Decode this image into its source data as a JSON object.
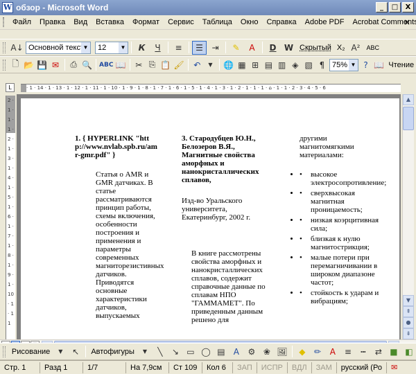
{
  "window": {
    "title": "обзор - Microsoft Word",
    "minimize": "_",
    "maximize": "□",
    "close": "X"
  },
  "menu": {
    "items": [
      "Файл",
      "Правка",
      "Вид",
      "Вставка",
      "Формат",
      "Сервис",
      "Таблица",
      "Окно",
      "Справка",
      "Adobe PDF",
      "Acrobat Comments"
    ],
    "close_doc": "×"
  },
  "format_toolbar": {
    "style": "Основной текст",
    "size": "12",
    "bold": "К",
    "underline": "Ч",
    "hidden_label": "Скрытый",
    "subscript": "X₂",
    "abc": "ABC"
  },
  "standard_toolbar": {
    "zoom": "75%",
    "read_label": "Чтение"
  },
  "ruler": {
    "h_ticks": "· 1 · 14 · 1 · 13 · 1 · 12 · 1 · 11 · 1 · 10 · 1 · 9 · 1 · 8 · 1 · 7 · 1 · 6 · 1 · 5 · 1 · 4 · 1 · 3 · 1 · 2 · 1 · 1 · 1 · ⌂ · 1 · 1 · 2 · 3 · 4 · 5 · 6",
    "v_ticks": "2 · 1 · 1 · 1 · 2 · 1 · 3 · 1 · 4 · 1 · 5 · 1 · 6 · 1 · 7 · 1 · 8 · 1 · 9 · 1 · 10 · 1 · 11"
  },
  "doc": {
    "col1_head": "1. { HYPERLINK \"http://www.nvlab.spb.ru/amr-gmr.pdf\" }",
    "col1_body": "Статья о AMR и GMR датчиках. В статье рассматриваются принцип работы, схемы включения, особенности построения и применения и параметры современных магниторезистивных датчиков. Приводятся основные характеристики датчиков, выпускаемых",
    "col2_head": "3. Стародубцев Ю.Н., Белозеров В.Я., Магнитные свойства аморфных и нанокристаллических сплавов,",
    "col2_pub": "Изд-во Уральского университета, Екатеринбург, 2002 г.",
    "col2_body": "В книге рассмотрены свойства аморфных и нанокристаллических сплавов, содержит справочные данные по сплавам НПО \"ГАММАМЕТ\". По приведенным данным решено для",
    "col3_intro": "другими магнитомягкими материалами:",
    "col3_list": [
      "высокое электросопротивление;",
      "сверхвысокая магнитная проницаемость;",
      "низкая коэрцитивная сила;",
      "близкая к нулю магнитострикция;",
      "малые потери при перемагничивании в широком диапазоне частот;",
      "стойкость к ударам и вибрациям;"
    ]
  },
  "drawing_toolbar": {
    "draw_label": "Рисование",
    "autoshapes_label": "Автофигуры"
  },
  "status": {
    "page": "Стр. 1",
    "section": "Разд 1",
    "pages": "1/7",
    "position": "На 7,9см",
    "line": "Ст 109",
    "column": "Кол 6",
    "rec": "ЗАП",
    "trk": "ИСПР",
    "ext": "ВДЛ",
    "ovr": "ЗАМ",
    "language": "русский (Ро"
  },
  "colors": {
    "title_bg": "#7c95c4",
    "chrome": "#ece9d8",
    "doc_bg": "#808080"
  }
}
